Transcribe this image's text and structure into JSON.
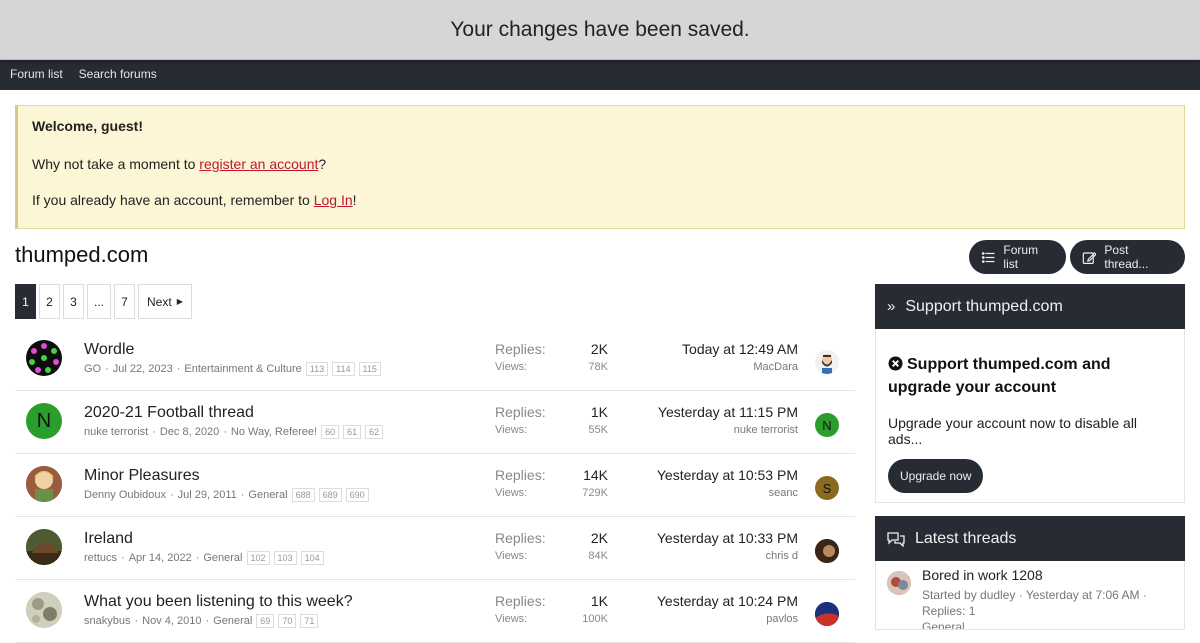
{
  "notice": "Your changes have been saved.",
  "nav": {
    "forum_list": "Forum list",
    "search_forums": "Search forums"
  },
  "welcome": {
    "title": "Welcome, guest!",
    "line1_prefix": "Why not take a moment to ",
    "line1_link": "register an account",
    "line1_suffix": "?",
    "line2_prefix": "If you already have an account, remember to ",
    "line2_link": "Log In",
    "line2_suffix": "!"
  },
  "forum": {
    "title": "thumped.com",
    "forum_list_btn": "Forum list",
    "post_thread_btn": "Post thread..."
  },
  "pager": {
    "pages": [
      "1",
      "2",
      "3",
      "...",
      "7"
    ],
    "next": "Next"
  },
  "threads": [
    {
      "title": "Wordle",
      "author": "GO",
      "date": "Jul 22, 2023",
      "forum": "Entertainment & Culture",
      "pages": [
        "113",
        "114",
        "115"
      ],
      "replies_label": "Replies:",
      "replies": "2K",
      "views_label": "Views:",
      "views": "78K",
      "last_time": "Today at 12:49 AM",
      "last_user": "MacDara"
    },
    {
      "title": "2020-21 Football thread",
      "author": "nuke terrorist",
      "date": "Dec 8, 2020",
      "forum": "No Way, Referee!",
      "avatar_letter": "N",
      "pages": [
        "60",
        "61",
        "62"
      ],
      "replies_label": "Replies:",
      "replies": "1K",
      "views_label": "Views:",
      "views": "55K",
      "last_time": "Yesterday at 11:15 PM",
      "last_user": "nuke terrorist",
      "last_letter": "N"
    },
    {
      "title": "Minor Pleasures",
      "author": "Denny Oubidoux",
      "date": "Jul 29, 2011",
      "forum": "General",
      "pages": [
        "688",
        "689",
        "690"
      ],
      "replies_label": "Replies:",
      "replies": "14K",
      "views_label": "Views:",
      "views": "729K",
      "last_time": "Yesterday at 10:53 PM",
      "last_user": "seanc",
      "last_letter": "S"
    },
    {
      "title": "Ireland",
      "author": "rettucs",
      "date": "Apr 14, 2022",
      "forum": "General",
      "pages": [
        "102",
        "103",
        "104"
      ],
      "replies_label": "Replies:",
      "replies": "2K",
      "views_label": "Views:",
      "views": "84K",
      "last_time": "Yesterday at 10:33 PM",
      "last_user": "chris d"
    },
    {
      "title": "What you been listening to this week?",
      "author": "snakybus",
      "date": "Nov 4, 2010",
      "forum": "General",
      "pages": [
        "69",
        "70",
        "71"
      ],
      "replies_label": "Replies:",
      "replies": "1K",
      "views_label": "Views:",
      "views": "100K",
      "last_time": "Yesterday at 10:24 PM",
      "last_user": "pavlos"
    }
  ],
  "sidebar": {
    "support_header": "Support thumped.com",
    "support_heading": "Support thumped.com and upgrade your account",
    "support_text": "Upgrade your account now to disable all ads...",
    "upgrade_btn": "Upgrade now",
    "latest_header": "Latest threads",
    "latest": {
      "title": "Bored in work 1208",
      "started": "Started by dudley · Yesterday at 7:06 AM ·",
      "replies": "Replies: 1",
      "forum": "General"
    }
  },
  "colors": {
    "dark": "#272b34",
    "link_red": "#c0182a",
    "welcome_bg": "#fcf5d6",
    "green_avatar": "#2a9d2a",
    "brown_avatar": "#8b6a1f"
  }
}
